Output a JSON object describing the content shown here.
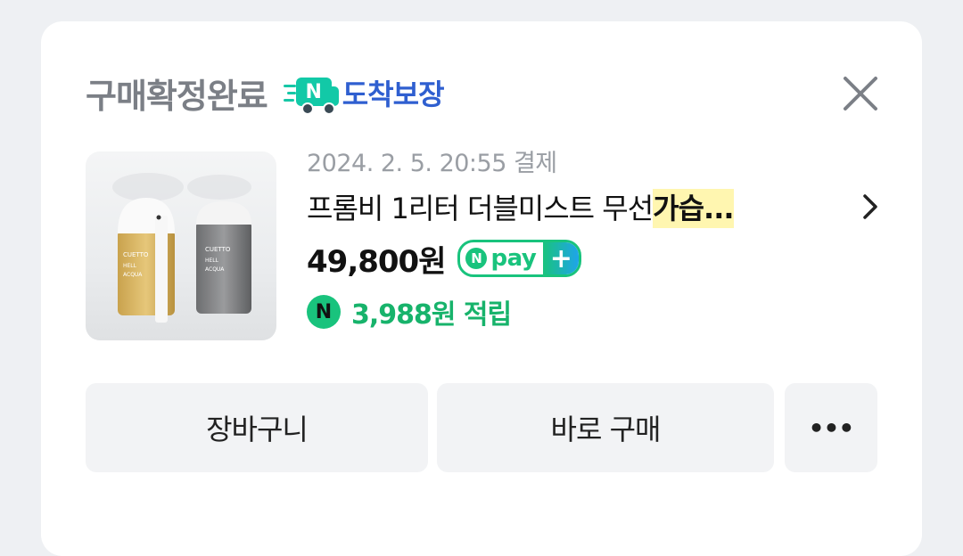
{
  "header": {
    "status": "구매확정완료",
    "badge_logo": "N",
    "badge_text": "도착보장",
    "close_icon": "close-icon"
  },
  "product": {
    "date": "2024. 2. 5. 20:55 결제",
    "name_part1": "프롬비 1리터 더블미스트 무선",
    "name_highlight": "가습...",
    "price": "49,800원",
    "npay_n": "N",
    "npay_text": "pay",
    "npay_plus": "+",
    "reward_icon_letter": "N",
    "reward_text": "3,988원 적립",
    "image_labels": {
      "left_brand": "CUETTO",
      "left_sub": "HELL",
      "left_sub2": "ACQUA",
      "right_brand": "CUETTO",
      "right_sub": "HELL",
      "right_sub2": "ACQUA"
    }
  },
  "buttons": {
    "cart": "장바구니",
    "buy": "바로 구매",
    "more": "•••"
  },
  "colors": {
    "npay_green": "#19c37d",
    "badge_blue": "#2f5fd0",
    "highlight": "#fff6b0"
  }
}
